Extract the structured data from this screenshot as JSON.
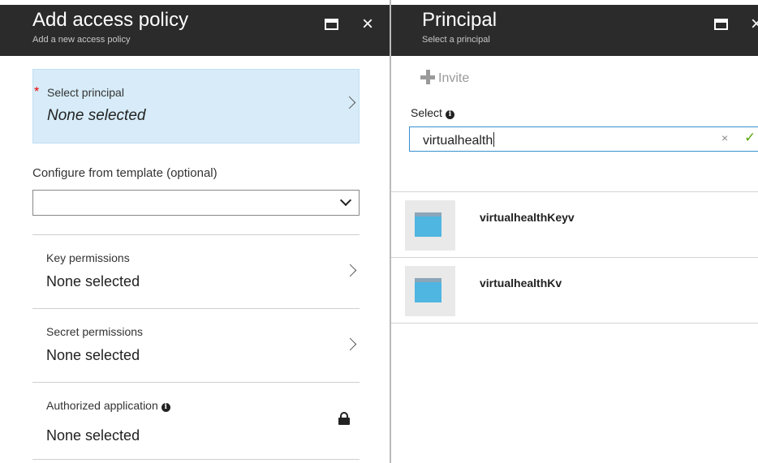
{
  "left_blade": {
    "title": "Add access policy",
    "subtitle": "Add a new access policy",
    "principal": {
      "label": "Select principal",
      "value": "None selected",
      "required_mark": "*"
    },
    "template": {
      "label": "Configure from template (optional)",
      "selected": ""
    },
    "key_permissions": {
      "label": "Key permissions",
      "value": "None selected"
    },
    "secret_permissions": {
      "label": "Secret permissions",
      "value": "None selected"
    },
    "authorized_application": {
      "label": "Authorized application",
      "value": "None selected",
      "locked": true
    }
  },
  "right_blade": {
    "title": "Principal",
    "subtitle": "Select a principal",
    "invite_label": "Invite",
    "select_label": "Select",
    "search_value": "virtualhealth",
    "results": [
      {
        "name": "virtualhealthKeyv",
        "icon": "app-registration-icon"
      },
      {
        "name": "virtualhealthKv",
        "icon": "app-registration-icon"
      }
    ]
  },
  "glyphs": {
    "info": "i",
    "close": "×",
    "clear": "×",
    "check": "✓"
  },
  "colors": {
    "header_bg": "#2b2b2b",
    "selected_row_bg": "#d7ecf8",
    "input_focus_border": "#3a8fd0",
    "valid_check": "#59a612",
    "required": "#e00000"
  }
}
